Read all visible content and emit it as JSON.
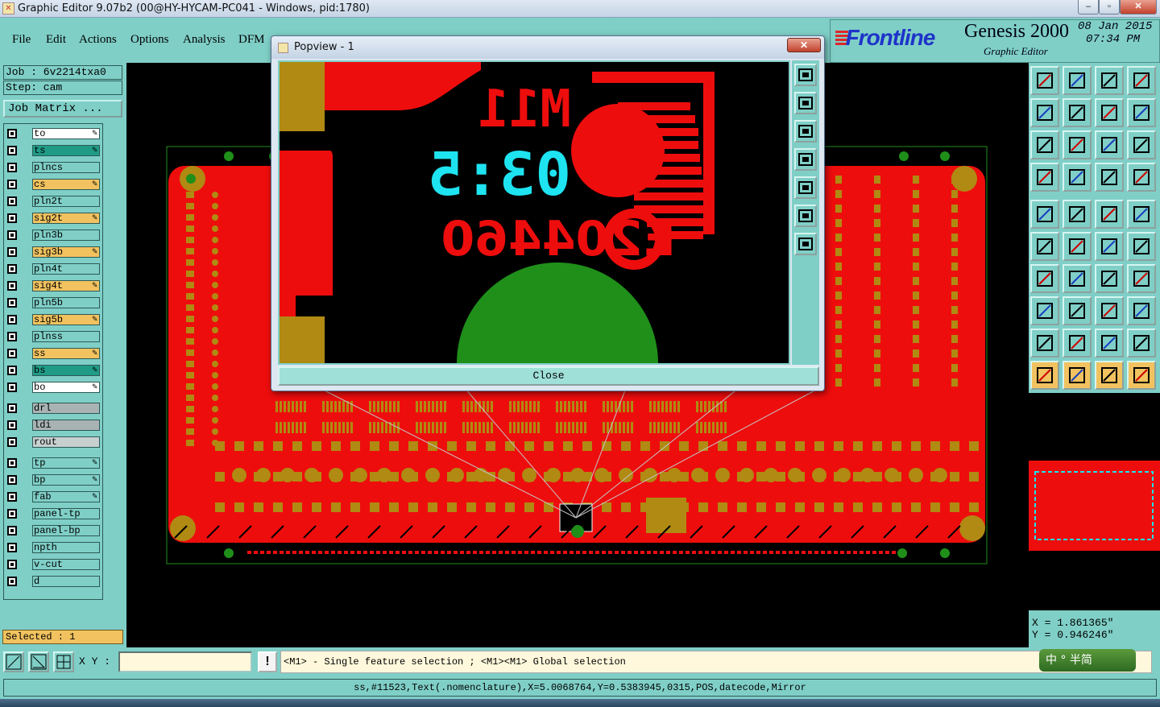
{
  "window": {
    "title": "Graphic Editor 9.07b2 (00@HY-HYCAM-PC041 - Windows, pid:1780)",
    "minimize": "–",
    "maximize": "▫",
    "close": "✕"
  },
  "menu": [
    "File",
    "Edit",
    "Actions",
    "Options",
    "Analysis",
    "DFM"
  ],
  "brand": {
    "logo": "Frontline",
    "product": "Genesis 2000",
    "subtitle": "Graphic Editor",
    "date": "08 Jan 2015",
    "time": "07:34 PM"
  },
  "job": {
    "job_label": "Job : 6v2214txa0",
    "step_label": "Step: cam",
    "matrix_button": "Job Matrix ..."
  },
  "layers": [
    {
      "name": "to",
      "color": "#ffffff",
      "pen": true
    },
    {
      "name": "ts",
      "color": "#1f9b86",
      "pen": true
    },
    {
      "name": "plncs",
      "color": "#7fcfc7",
      "pen": false
    },
    {
      "name": "cs",
      "color": "#f1c25f",
      "pen": true
    },
    {
      "name": "pln2t",
      "color": "#7fcfc7",
      "pen": false
    },
    {
      "name": "sig2t",
      "color": "#f1c25f",
      "pen": true
    },
    {
      "name": "pln3b",
      "color": "#7fcfc7",
      "pen": false
    },
    {
      "name": "sig3b",
      "color": "#f1c25f",
      "pen": true
    },
    {
      "name": "pln4t",
      "color": "#7fcfc7",
      "pen": false
    },
    {
      "name": "sig4t",
      "color": "#f1c25f",
      "pen": true
    },
    {
      "name": "pln5b",
      "color": "#7fcfc7",
      "pen": false
    },
    {
      "name": "sig5b",
      "color": "#f1c25f",
      "pen": true
    },
    {
      "name": "plnss",
      "color": "#7fcfc7",
      "pen": false
    },
    {
      "name": "ss",
      "color": "#f1c25f",
      "pen": true
    },
    {
      "name": "bs",
      "color": "#1f9b86",
      "pen": true
    },
    {
      "name": "bo",
      "color": "#ffffff",
      "pen": true
    },
    {
      "name": "drl",
      "color": "#a9b3b3",
      "pen": false
    },
    {
      "name": "ldi",
      "color": "#a9b3b3",
      "pen": false
    },
    {
      "name": "rout",
      "color": "#c8cfcf",
      "pen": false
    },
    {
      "name": "tp",
      "color": "#7fcfc7",
      "pen": true
    },
    {
      "name": "bp",
      "color": "#7fcfc7",
      "pen": true
    },
    {
      "name": "fab",
      "color": "#7fcfc7",
      "pen": true
    },
    {
      "name": "panel-tp",
      "color": "#7fcfc7",
      "pen": false
    },
    {
      "name": "panel-bp",
      "color": "#7fcfc7",
      "pen": false
    },
    {
      "name": "npth",
      "color": "#7fcfc7",
      "pen": false
    },
    {
      "name": "v-cut",
      "color": "#7fcfc7",
      "pen": false
    },
    {
      "name": "d",
      "color": "#7fcfc7",
      "pen": false
    }
  ],
  "selected": "Selected : 1",
  "popup": {
    "title": "Popview - 1",
    "close_x": "✕",
    "close_button": "Close",
    "silk_text_1": "M11",
    "silk_text_2": "03:5",
    "silk_text_3": "E204460"
  },
  "coordinates": {
    "x": "X = 1.861365\"",
    "y": "Y = 0.946246\""
  },
  "bottom": {
    "xy_label": "X Y :",
    "xy_value": "",
    "warn": "!",
    "hint": "<M1> - Single feature selection ; <M1><M1> Global selection",
    "ime": "中 ° 半简",
    "status": "ss,#11523,Text(.nomenclature),X=5.0068764,Y=0.5383945,0315,POS,datecode,Mirror"
  },
  "colors": {
    "teal_bg": "#7fcfc7",
    "copper": "#ee0d0d",
    "pad_gold": "#b08a12",
    "mark_green": "#1f8f1a",
    "silk_cyan": "#1ee3f0"
  }
}
